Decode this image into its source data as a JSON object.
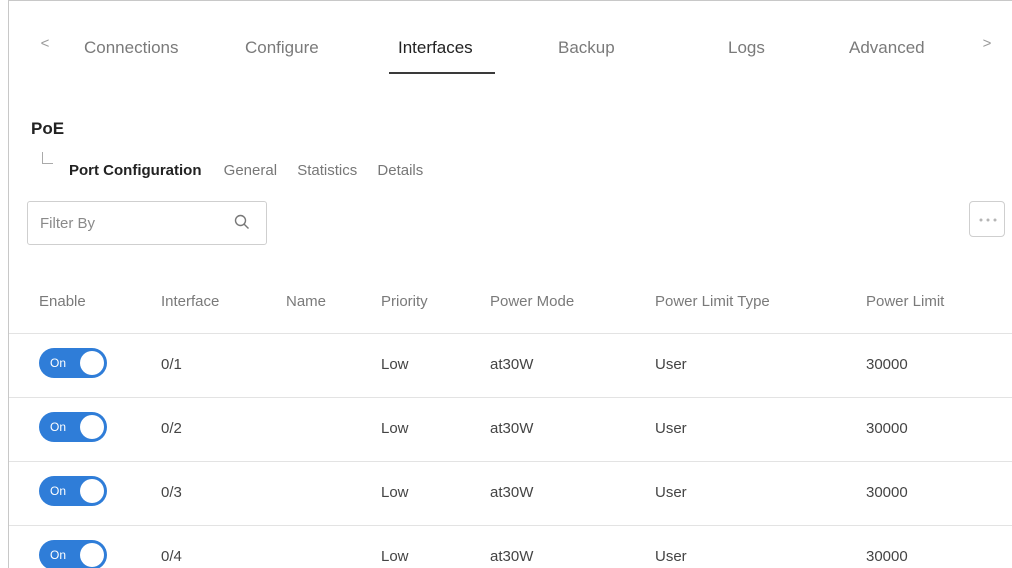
{
  "tabs": {
    "prev_arrow": "<",
    "next_arrow": ">",
    "items": [
      {
        "label": "Connections",
        "active": false
      },
      {
        "label": "Configure",
        "active": false
      },
      {
        "label": "Interfaces",
        "active": true
      },
      {
        "label": "Backup",
        "active": false
      },
      {
        "label": "Logs",
        "active": false
      },
      {
        "label": "Advanced",
        "active": false
      }
    ]
  },
  "section": {
    "title": "PoE",
    "subtabs": [
      {
        "label": "Port Configuration",
        "active": true
      },
      {
        "label": "General",
        "active": false
      },
      {
        "label": "Statistics",
        "active": false
      },
      {
        "label": "Details",
        "active": false
      }
    ]
  },
  "filter": {
    "placeholder": "Filter By",
    "value": ""
  },
  "icons": {
    "search": "search-icon",
    "more": "more-options-icon"
  },
  "colors": {
    "toggle_on": "#2f7dd8"
  },
  "table": {
    "headers": {
      "enable": "Enable",
      "interface": "Interface",
      "name": "Name",
      "priority": "Priority",
      "power_mode": "Power Mode",
      "power_limit_type": "Power Limit Type",
      "power_limit": "Power Limit"
    },
    "rows": [
      {
        "enable": "On",
        "interface": "0/1",
        "name": "",
        "priority": "Low",
        "power_mode": "at30W",
        "power_limit_type": "User",
        "power_limit": "30000"
      },
      {
        "enable": "On",
        "interface": "0/2",
        "name": "",
        "priority": "Low",
        "power_mode": "at30W",
        "power_limit_type": "User",
        "power_limit": "30000"
      },
      {
        "enable": "On",
        "interface": "0/3",
        "name": "",
        "priority": "Low",
        "power_mode": "at30W",
        "power_limit_type": "User",
        "power_limit": "30000"
      },
      {
        "enable": "On",
        "interface": "0/4",
        "name": "",
        "priority": "Low",
        "power_mode": "at30W",
        "power_limit_type": "User",
        "power_limit": "30000"
      }
    ]
  }
}
